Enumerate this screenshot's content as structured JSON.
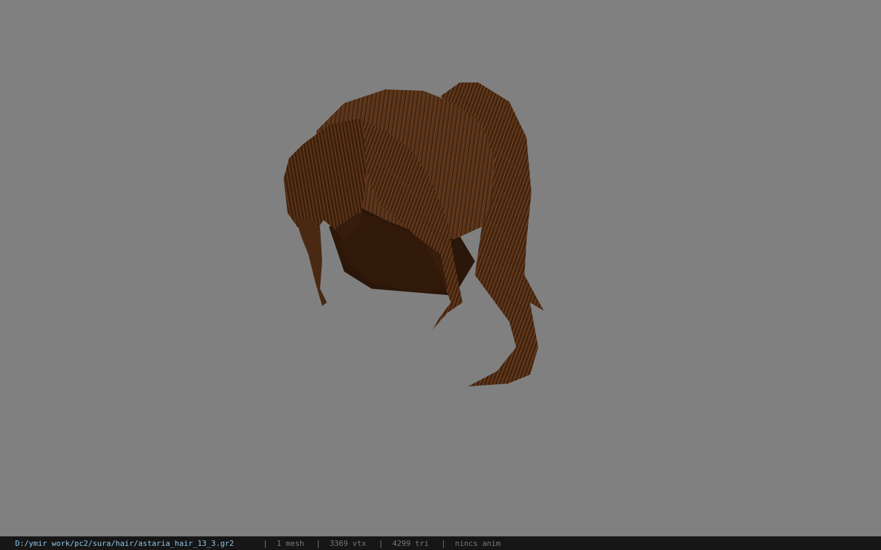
{
  "viewer": {
    "background_color": "#808080",
    "model": {
      "subject": "hair-mesh",
      "base_color": "#4a2a15",
      "highlight_color": "#7a4a25",
      "shadow_color": "#2b160a"
    }
  },
  "status_bar": {
    "file_path": "D:/ymir work/pc2/sura/hair/astaria_hair_13_3.gr2",
    "separator": "|",
    "mesh_count": "1 mesh",
    "vertex_count": "3369 vtx",
    "triangle_count": "4299 tri",
    "animation": "nincs anim",
    "path_color": "#8fc7e8",
    "text_color": "#7a7a7a"
  }
}
